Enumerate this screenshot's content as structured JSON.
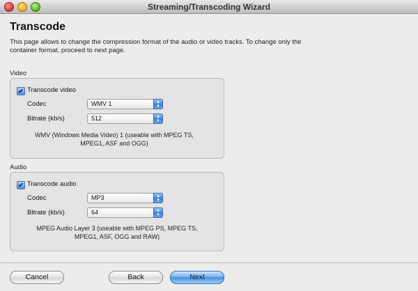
{
  "window": {
    "title": "Streaming/Transcoding Wizard"
  },
  "page": {
    "title": "Transcode",
    "description": "This page allows to change the compression format of the audio or video tracks. To change only the container format, proceed to next page."
  },
  "video": {
    "group_label": "Video",
    "transcode_label": "Transcode video",
    "transcode_checked": true,
    "codec_label": "Codec",
    "codec_value": "WMV 1",
    "bitrate_label": "Bitrate (kb/s)",
    "bitrate_value": "512",
    "note": "WMV (Windows Media Video) 1 (useable with MPEG TS, MPEG1, ASF and OGG)"
  },
  "audio": {
    "group_label": "Audio",
    "transcode_label": "Transcode audio",
    "transcode_checked": true,
    "codec_label": "Codec",
    "codec_value": "MP3",
    "bitrate_label": "Bitrate (kb/s)",
    "bitrate_value": "64",
    "note": "MPEG Audio Layer 3 (useable with MPEG PS, MPEG TS, MPEG1, ASF, OGG and RAW)"
  },
  "buttons": {
    "cancel": "Cancel",
    "back": "Back",
    "next": "Next"
  },
  "checkmark": "✔"
}
